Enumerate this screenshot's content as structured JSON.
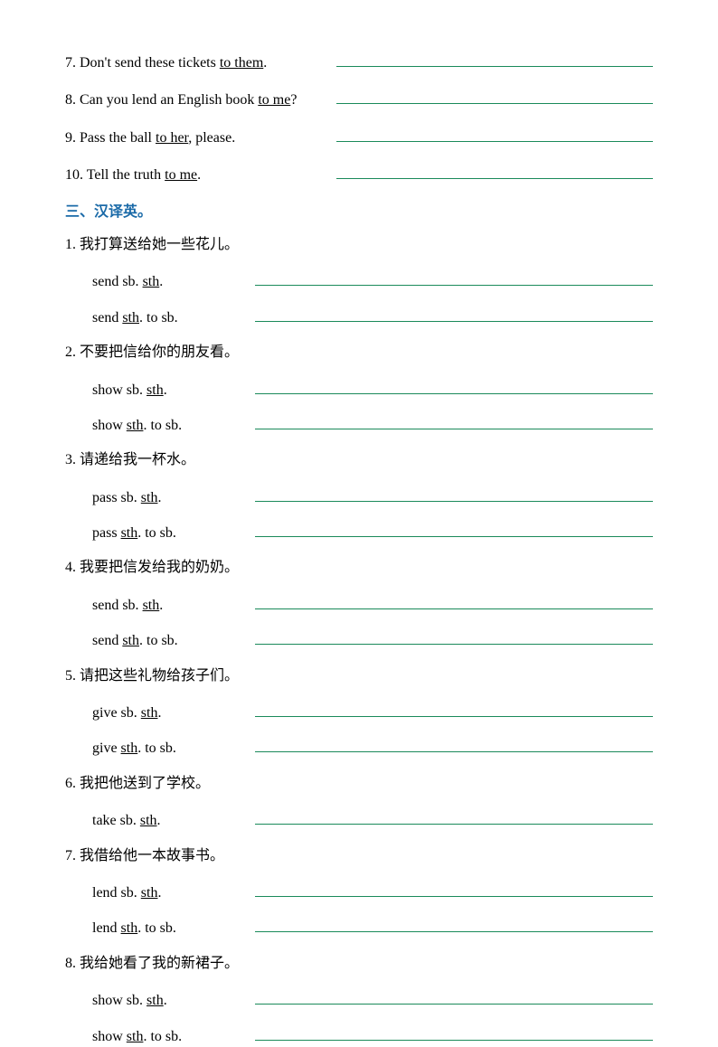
{
  "rewrite": {
    "q7": {
      "pre": "7. Don't send these tickets ",
      "u": "to them",
      "post": "."
    },
    "q8": {
      "pre": "8. Can you lend an English book ",
      "u": "to me",
      "post": "?"
    },
    "q9": {
      "pre": "9. Pass the ball ",
      "u": "to her",
      "post": ", please."
    },
    "q10": {
      "pre": "10. Tell the truth ",
      "u": "to me",
      "post": "."
    }
  },
  "section3": {
    "title": "三、汉译英。",
    "items": [
      {
        "num": "1. ",
        "cn": "我打算送给她一些花儿。",
        "patterns": [
          {
            "a": "send sb. ",
            "b": "sth",
            "c": "."
          },
          {
            "a": "send ",
            "b": "sth",
            "c": ". to sb."
          }
        ]
      },
      {
        "num": "2. ",
        "cn": "不要把信给你的朋友看。",
        "patterns": [
          {
            "a": "show sb. ",
            "b": "sth",
            "c": "."
          },
          {
            "a": "show ",
            "b": "sth",
            "c": ". to sb."
          }
        ]
      },
      {
        "num": "3. ",
        "cn": "请递给我一杯水。",
        "patterns": [
          {
            "a": "pass sb. ",
            "b": "sth",
            "c": "."
          },
          {
            "a": "pass ",
            "b": "sth",
            "c": ". to sb."
          }
        ]
      },
      {
        "num": "4. ",
        "cn": "我要把信发给我的奶奶。",
        "patterns": [
          {
            "a": "send sb. ",
            "b": "sth",
            "c": "."
          },
          {
            "a": "send ",
            "b": "sth",
            "c": ". to sb."
          }
        ]
      },
      {
        "num": "5. ",
        "cn": "请把这些礼物给孩子们。",
        "patterns": [
          {
            "a": "give sb. ",
            "b": "sth",
            "c": "."
          },
          {
            "a": "give ",
            "b": "sth",
            "c": ". to sb."
          }
        ]
      },
      {
        "num": "6. ",
        "cn": "我把他送到了学校。",
        "patterns": [
          {
            "a": "take sb. ",
            "b": "sth",
            "c": "."
          }
        ]
      },
      {
        "num": "7. ",
        "cn": "我借给他一本故事书。",
        "patterns": [
          {
            "a": "lend sb. ",
            "b": "sth",
            "c": "."
          },
          {
            "a": "lend ",
            "b": "sth",
            "c": ". to sb."
          }
        ]
      },
      {
        "num": "8. ",
        "cn": "我给她看了我的新裙子。",
        "patterns": [
          {
            "a": "show sb. ",
            "b": "sth",
            "c": "."
          },
          {
            "a": "show ",
            "b": "sth",
            "c": ". to sb."
          }
        ]
      }
    ]
  }
}
